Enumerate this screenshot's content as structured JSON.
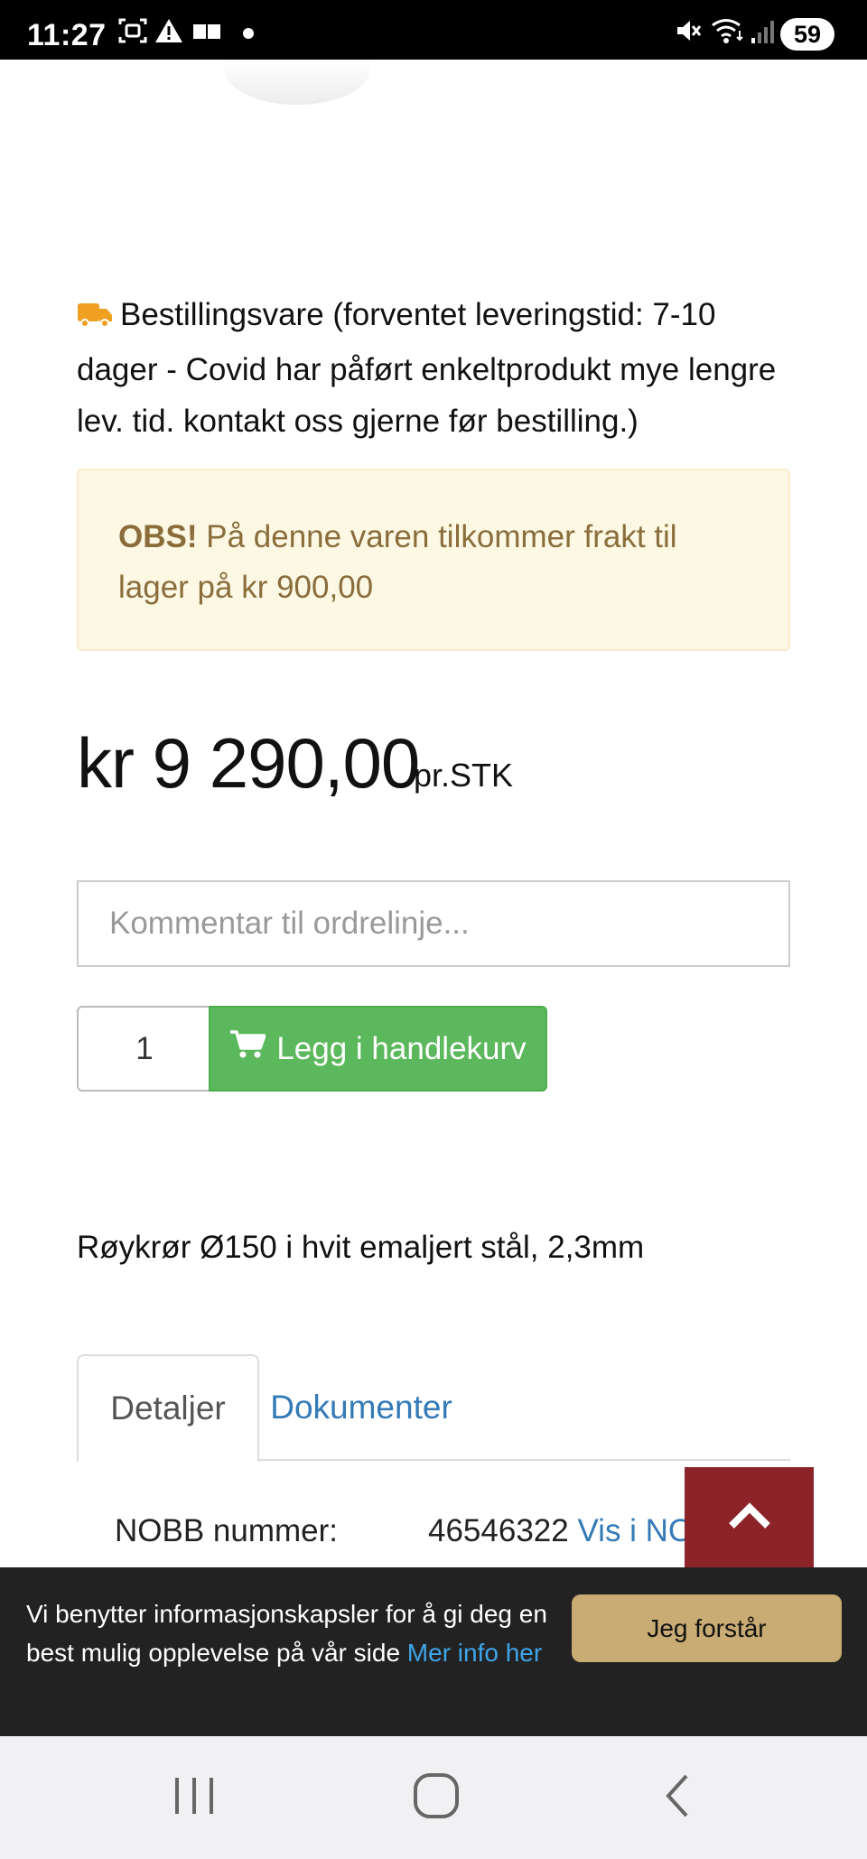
{
  "status_bar": {
    "time": "11:27",
    "battery": "59",
    "left_icons": [
      "screenshot-icon",
      "warning-icon",
      "message-icon",
      "dot-icon"
    ],
    "right_icons": [
      "mute-icon",
      "wifi-icon",
      "signal-icon"
    ]
  },
  "product": {
    "stock_text": "Bestillingsvare (forventet leveringstid: 7-10 dager - Covid har påført enkeltprodukt mye lengre lev. tid. kontakt oss gjerne før bestilling.)",
    "alert_strong": "OBS!",
    "alert_text": " På denne varen tilkommer frakt til lager på kr 900,00",
    "price": "kr 9 290,00",
    "price_unit": "pr.STK",
    "comment_placeholder": "Kommentar til ordrelinje...",
    "quantity": "1",
    "cart_button_label": "Legg i handlekurv",
    "description": "Røykrør Ø150 i hvit emaljert stål, 2,3mm"
  },
  "tabs": [
    {
      "label": "Detaljer",
      "active": true
    },
    {
      "label": "Dokumenter",
      "active": false
    }
  ],
  "details": {
    "nobb_label": "NOBB nummer:",
    "nobb_value": "46546322",
    "nobb_link": "Vis i NOB"
  },
  "cookie_banner": {
    "text": "Vi benytter informasjonskapsler for å gi deg en best mulig opplevelse på vår side ",
    "link": "Mer info her",
    "button": "Jeg forstår"
  },
  "colors": {
    "status_bar_bg": "#000000",
    "alert_bg": "#fcf8e3",
    "alert_text": "#8a6d3b",
    "cart_button": "#5cb85c",
    "link": "#337ab7",
    "scroll_top_button": "#8b2328",
    "cookie_bg": "#222222",
    "cookie_button": "#c9ab74",
    "stock_truck_icon": "#f0a020"
  }
}
